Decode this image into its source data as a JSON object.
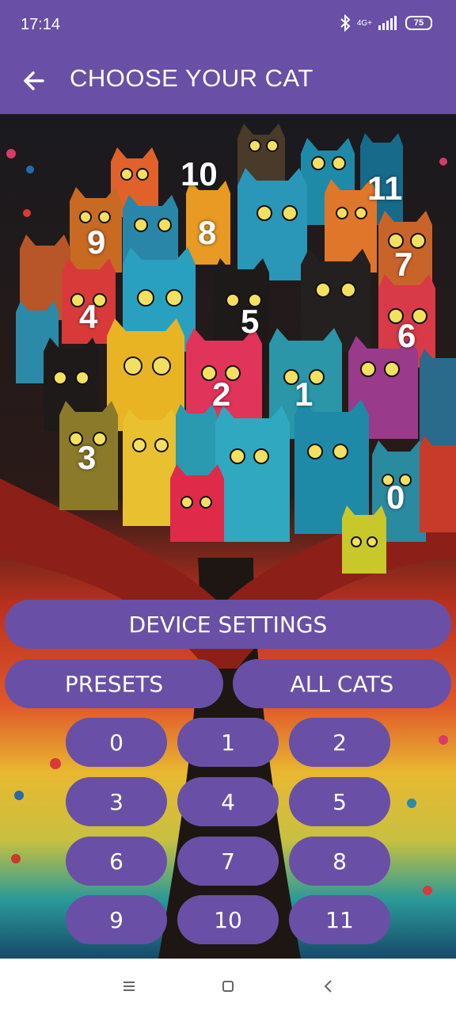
{
  "status": {
    "time": "17:14",
    "network": "4G+",
    "battery": "75"
  },
  "appbar": {
    "title": "CHOOSE YOUR CAT"
  },
  "overlay_numbers": [
    "10",
    "11",
    "9",
    "8",
    "7",
    "4",
    "5",
    "6",
    "2",
    "1",
    "3",
    "0"
  ],
  "buttons": {
    "device_settings": "DEVICE SETTINGS",
    "presets": "PRESETS",
    "all_cats": "ALL CATS",
    "grid": [
      "0",
      "1",
      "2",
      "3",
      "4",
      "5",
      "6",
      "7",
      "8",
      "9",
      "10",
      "11"
    ]
  },
  "colors": {
    "accent": "#6950a6"
  }
}
